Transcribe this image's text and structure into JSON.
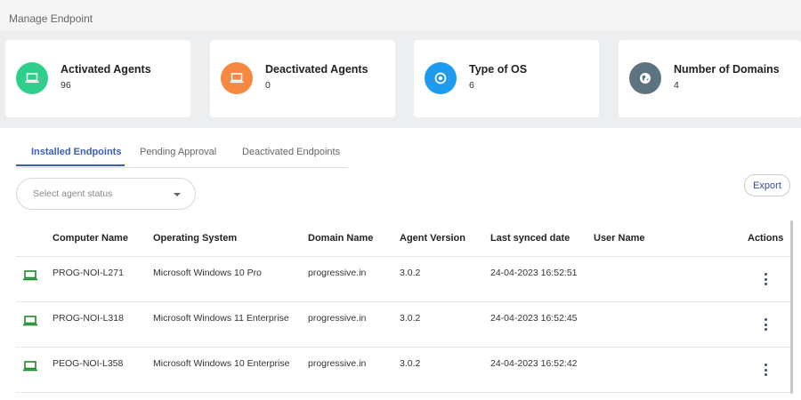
{
  "header": {
    "title": "Manage Endpoint"
  },
  "cards": [
    {
      "label": "Activated Agents",
      "value": "96",
      "color": "#2ecf8a",
      "icon": "laptop-icon"
    },
    {
      "label": "Deactivated Agents",
      "value": "0",
      "color": "#f6893f",
      "icon": "laptop-icon"
    },
    {
      "label": "Type of OS",
      "value": "6",
      "color": "#1e9bef",
      "icon": "os-target-icon"
    },
    {
      "label": "Number of Domains",
      "value": "4",
      "color": "#5e7380",
      "icon": "globe-icon"
    }
  ],
  "tabs": [
    {
      "label": "Installed Endpoints",
      "active": true
    },
    {
      "label": "Pending Approval",
      "active": false
    },
    {
      "label": "Deactivated Endpoints",
      "active": false
    }
  ],
  "filter": {
    "placeholder": "Select agent status"
  },
  "toolbar": {
    "export_label": "Export"
  },
  "table": {
    "columns": [
      "Computer Name",
      "Operating System",
      "Domain Name",
      "Agent Version",
      "Last synced date",
      "User Name",
      "Actions"
    ],
    "rows": [
      {
        "computer": "PROG-NOI-L271",
        "os": "Microsoft Windows 10 Pro",
        "domain": "progressive.in",
        "version": "3.0.2",
        "synced": "24-04-2023 16:52:51",
        "user": ""
      },
      {
        "computer": "PROG-NOI-L318",
        "os": "Microsoft Windows 11 Enterprise",
        "domain": "progressive.in",
        "version": "3.0.2",
        "synced": "24-04-2023 16:52:45",
        "user": ""
      },
      {
        "computer": "PEOG-NOI-L358",
        "os": "Microsoft Windows 10 Enterprise",
        "domain": "progressive.in",
        "version": "3.0.2",
        "synced": "24-04-2023 16:52:42",
        "user": ""
      }
    ]
  },
  "colors": {
    "accent": "#3a5db5",
    "row_icon": "#1c8a2a"
  }
}
